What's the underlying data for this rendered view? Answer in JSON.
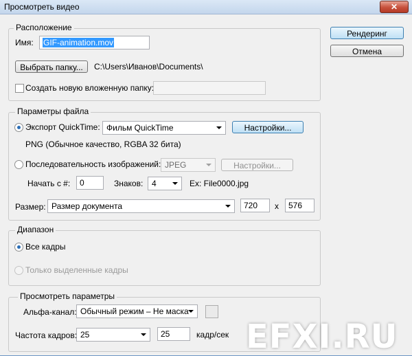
{
  "window": {
    "title": "Просмотреть видео",
    "close_glyph": "✕"
  },
  "buttons": {
    "render": "Рендеринг",
    "cancel": "Отмена"
  },
  "location": {
    "legend": "Расположение",
    "name_label": "Имя:",
    "name_value": "GIF-animation.mov",
    "choose_folder": "Выбрать папку...",
    "path": "C:\\Users\\Иванов\\Documents\\",
    "create_subfolder": "Создать новую вложенную папку:",
    "subfolder_value": ""
  },
  "file_params": {
    "legend": "Параметры файла",
    "export_qt_label": "Экспорт QuickTime:",
    "export_qt_value": "Фильм QuickTime",
    "settings": "Настройки...",
    "codec_info": "PNG (Обычное качество, RGBA 32 бита)",
    "seq_label": "Последовательность изображений:",
    "seq_format": "JPEG",
    "seq_settings": "Настройки...",
    "start_label": "Начать с #:",
    "start_value": "0",
    "digits_label": "Знаков:",
    "digits_value": "4",
    "example": "Ex: File0000.jpg",
    "size_label": "Размер:",
    "size_value": "Размер документа",
    "width": "720",
    "x_sep": "x",
    "height": "576"
  },
  "range": {
    "legend": "Диапазон",
    "all_frames": "Все кадры",
    "selected_frames": "Только выделенные кадры"
  },
  "render_options": {
    "legend": "Просмотреть параметры",
    "alpha_label": "Альфа-канал:",
    "alpha_value": "Обычный режим – Не маска",
    "fps_label": "Частота кадров:",
    "fps_select": "25",
    "fps_value": "25",
    "fps_unit": "кадр/сек"
  },
  "watermark": "EFXI.RU",
  "colors": {
    "accent": "#3399ff",
    "radio_dot": "#2a6db5"
  }
}
